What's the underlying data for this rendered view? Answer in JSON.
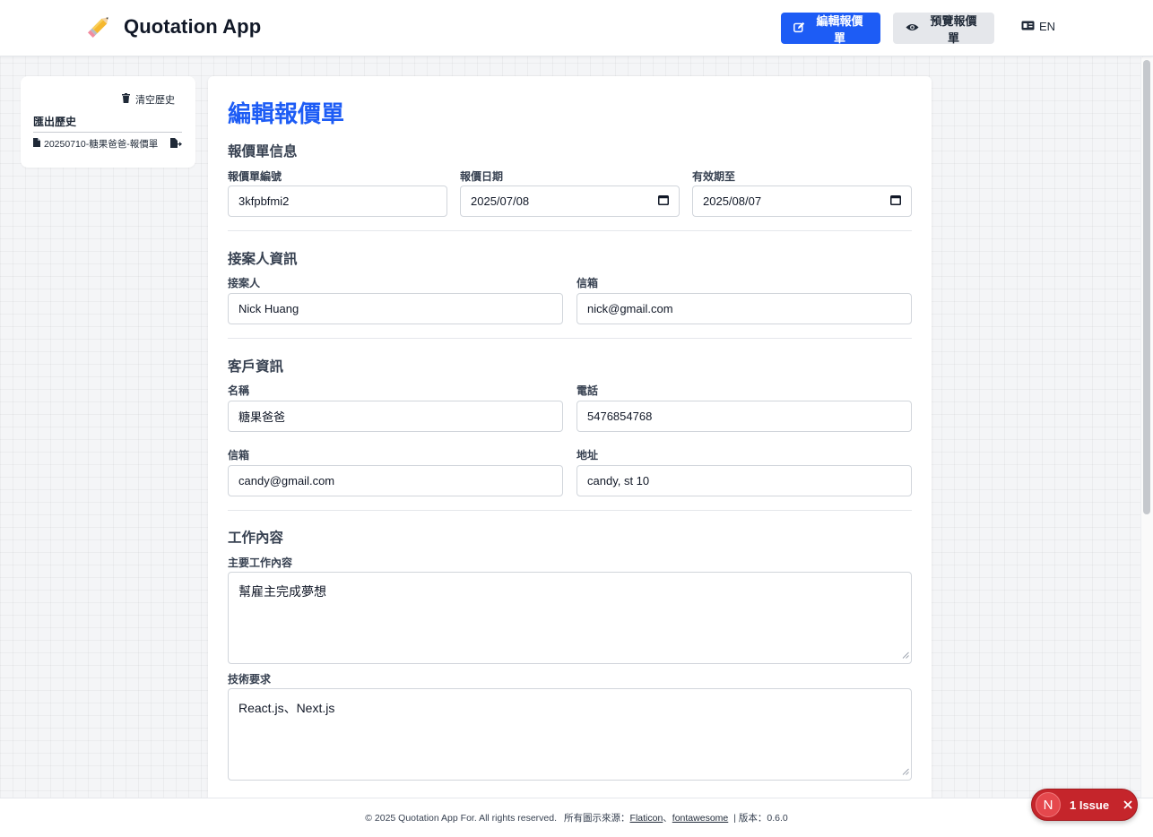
{
  "header": {
    "app_title": "Quotation App",
    "edit_label": "編輯報價單",
    "preview_label": "預覽報價單",
    "lang_label": "EN"
  },
  "history": {
    "clear_label": "清空歷史",
    "heading": "匯出歷史",
    "items": [
      {
        "name": "20250710-糖果爸爸-報價單"
      }
    ]
  },
  "form": {
    "page_title": "編輯報價單",
    "quote_info": {
      "title": "報價單信息",
      "number_label": "報價單編號",
      "number_value": "3kfpbfmi2",
      "date_label": "報價日期",
      "date_value": "2025/07/08",
      "valid_label": "有效期至",
      "valid_value": "2025/08/07"
    },
    "contact": {
      "title": "接案人資訊",
      "name_label": "接案人",
      "name_value": "Nick Huang",
      "email_label": "信箱",
      "email_value": "nick@gmail.com"
    },
    "client": {
      "title": "客戶資訊",
      "name_label": "名稱",
      "name_value": "糖果爸爸",
      "phone_label": "電話",
      "phone_value": "5476854768",
      "email_label": "信箱",
      "email_value": "candy@gmail.com",
      "address_label": "地址",
      "address_value": "candy, st 10"
    },
    "work": {
      "title": "工作內容",
      "main_label": "主要工作內容",
      "main_value": "幫雇主完成夢想",
      "tech_label": "技術要求",
      "tech_value": "React.js、Next.js"
    }
  },
  "footer": {
    "copyright": "© 2025 Quotation App For. All rights reserved.",
    "sources_label": "所有圖示來源：",
    "link_flaticon": "Flaticon",
    "separator": "、",
    "link_fontawesome": "fontawesome",
    "version": "| 版本：0.6.0"
  },
  "issue_badge": {
    "logo": "N",
    "text": "1 Issue"
  },
  "colors": {
    "primary": "#1d5cf5",
    "issue": "#c5252b"
  }
}
